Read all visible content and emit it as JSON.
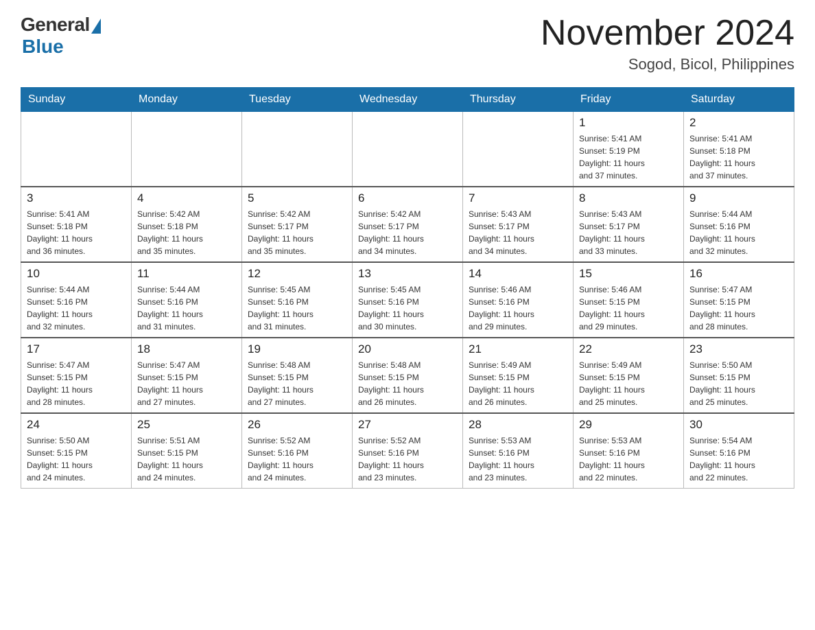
{
  "header": {
    "logo_general": "General",
    "logo_blue": "Blue",
    "month_year": "November 2024",
    "location": "Sogod, Bicol, Philippines"
  },
  "days_of_week": [
    "Sunday",
    "Monday",
    "Tuesday",
    "Wednesday",
    "Thursday",
    "Friday",
    "Saturday"
  ],
  "weeks": [
    [
      {
        "day": "",
        "info": ""
      },
      {
        "day": "",
        "info": ""
      },
      {
        "day": "",
        "info": ""
      },
      {
        "day": "",
        "info": ""
      },
      {
        "day": "",
        "info": ""
      },
      {
        "day": "1",
        "info": "Sunrise: 5:41 AM\nSunset: 5:19 PM\nDaylight: 11 hours\nand 37 minutes."
      },
      {
        "day": "2",
        "info": "Sunrise: 5:41 AM\nSunset: 5:18 PM\nDaylight: 11 hours\nand 37 minutes."
      }
    ],
    [
      {
        "day": "3",
        "info": "Sunrise: 5:41 AM\nSunset: 5:18 PM\nDaylight: 11 hours\nand 36 minutes."
      },
      {
        "day": "4",
        "info": "Sunrise: 5:42 AM\nSunset: 5:18 PM\nDaylight: 11 hours\nand 35 minutes."
      },
      {
        "day": "5",
        "info": "Sunrise: 5:42 AM\nSunset: 5:17 PM\nDaylight: 11 hours\nand 35 minutes."
      },
      {
        "day": "6",
        "info": "Sunrise: 5:42 AM\nSunset: 5:17 PM\nDaylight: 11 hours\nand 34 minutes."
      },
      {
        "day": "7",
        "info": "Sunrise: 5:43 AM\nSunset: 5:17 PM\nDaylight: 11 hours\nand 34 minutes."
      },
      {
        "day": "8",
        "info": "Sunrise: 5:43 AM\nSunset: 5:17 PM\nDaylight: 11 hours\nand 33 minutes."
      },
      {
        "day": "9",
        "info": "Sunrise: 5:44 AM\nSunset: 5:16 PM\nDaylight: 11 hours\nand 32 minutes."
      }
    ],
    [
      {
        "day": "10",
        "info": "Sunrise: 5:44 AM\nSunset: 5:16 PM\nDaylight: 11 hours\nand 32 minutes."
      },
      {
        "day": "11",
        "info": "Sunrise: 5:44 AM\nSunset: 5:16 PM\nDaylight: 11 hours\nand 31 minutes."
      },
      {
        "day": "12",
        "info": "Sunrise: 5:45 AM\nSunset: 5:16 PM\nDaylight: 11 hours\nand 31 minutes."
      },
      {
        "day": "13",
        "info": "Sunrise: 5:45 AM\nSunset: 5:16 PM\nDaylight: 11 hours\nand 30 minutes."
      },
      {
        "day": "14",
        "info": "Sunrise: 5:46 AM\nSunset: 5:16 PM\nDaylight: 11 hours\nand 29 minutes."
      },
      {
        "day": "15",
        "info": "Sunrise: 5:46 AM\nSunset: 5:15 PM\nDaylight: 11 hours\nand 29 minutes."
      },
      {
        "day": "16",
        "info": "Sunrise: 5:47 AM\nSunset: 5:15 PM\nDaylight: 11 hours\nand 28 minutes."
      }
    ],
    [
      {
        "day": "17",
        "info": "Sunrise: 5:47 AM\nSunset: 5:15 PM\nDaylight: 11 hours\nand 28 minutes."
      },
      {
        "day": "18",
        "info": "Sunrise: 5:47 AM\nSunset: 5:15 PM\nDaylight: 11 hours\nand 27 minutes."
      },
      {
        "day": "19",
        "info": "Sunrise: 5:48 AM\nSunset: 5:15 PM\nDaylight: 11 hours\nand 27 minutes."
      },
      {
        "day": "20",
        "info": "Sunrise: 5:48 AM\nSunset: 5:15 PM\nDaylight: 11 hours\nand 26 minutes."
      },
      {
        "day": "21",
        "info": "Sunrise: 5:49 AM\nSunset: 5:15 PM\nDaylight: 11 hours\nand 26 minutes."
      },
      {
        "day": "22",
        "info": "Sunrise: 5:49 AM\nSunset: 5:15 PM\nDaylight: 11 hours\nand 25 minutes."
      },
      {
        "day": "23",
        "info": "Sunrise: 5:50 AM\nSunset: 5:15 PM\nDaylight: 11 hours\nand 25 minutes."
      }
    ],
    [
      {
        "day": "24",
        "info": "Sunrise: 5:50 AM\nSunset: 5:15 PM\nDaylight: 11 hours\nand 24 minutes."
      },
      {
        "day": "25",
        "info": "Sunrise: 5:51 AM\nSunset: 5:15 PM\nDaylight: 11 hours\nand 24 minutes."
      },
      {
        "day": "26",
        "info": "Sunrise: 5:52 AM\nSunset: 5:16 PM\nDaylight: 11 hours\nand 24 minutes."
      },
      {
        "day": "27",
        "info": "Sunrise: 5:52 AM\nSunset: 5:16 PM\nDaylight: 11 hours\nand 23 minutes."
      },
      {
        "day": "28",
        "info": "Sunrise: 5:53 AM\nSunset: 5:16 PM\nDaylight: 11 hours\nand 23 minutes."
      },
      {
        "day": "29",
        "info": "Sunrise: 5:53 AM\nSunset: 5:16 PM\nDaylight: 11 hours\nand 22 minutes."
      },
      {
        "day": "30",
        "info": "Sunrise: 5:54 AM\nSunset: 5:16 PM\nDaylight: 11 hours\nand 22 minutes."
      }
    ]
  ]
}
